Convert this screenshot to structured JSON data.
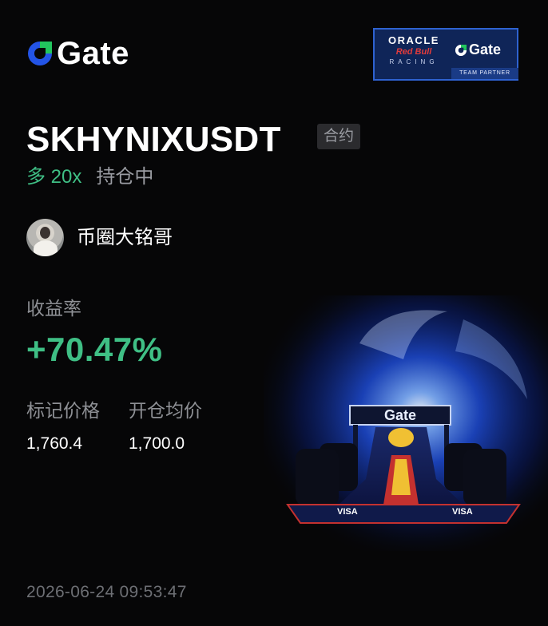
{
  "brand": {
    "name": "Gate",
    "icon": "gate-logo-icon"
  },
  "partner": {
    "oracle": "ORACLE",
    "redbull": "Red Bull",
    "racing": "RACING",
    "gate": "Gate",
    "footer": "TEAM PARTNER"
  },
  "position": {
    "symbol": "SKHYNIXUSDT",
    "type_badge": "合约",
    "side_leverage": "多 20x",
    "status": "持仓中"
  },
  "trader": {
    "name": "币圈大铭哥",
    "avatar": "trader-avatar"
  },
  "stats": {
    "roi_label": "收益率",
    "roi_value": "+70.47%",
    "mark_price_label": "标记价格",
    "mark_price": "1,760.4",
    "entry_price_label": "开仓均价",
    "entry_price": "1,700.0"
  },
  "timestamp": "2026-06-24 09:53:47",
  "art": {
    "car_wing_text": "Gate",
    "car_side_text": "VISA"
  },
  "colors": {
    "background": "#060607",
    "positive": "#3fbf85",
    "muted": "#8e9095",
    "badge_bg": "#2b2b2e",
    "brand_blue": "#2354e6",
    "brand_green": "#22c55e"
  }
}
